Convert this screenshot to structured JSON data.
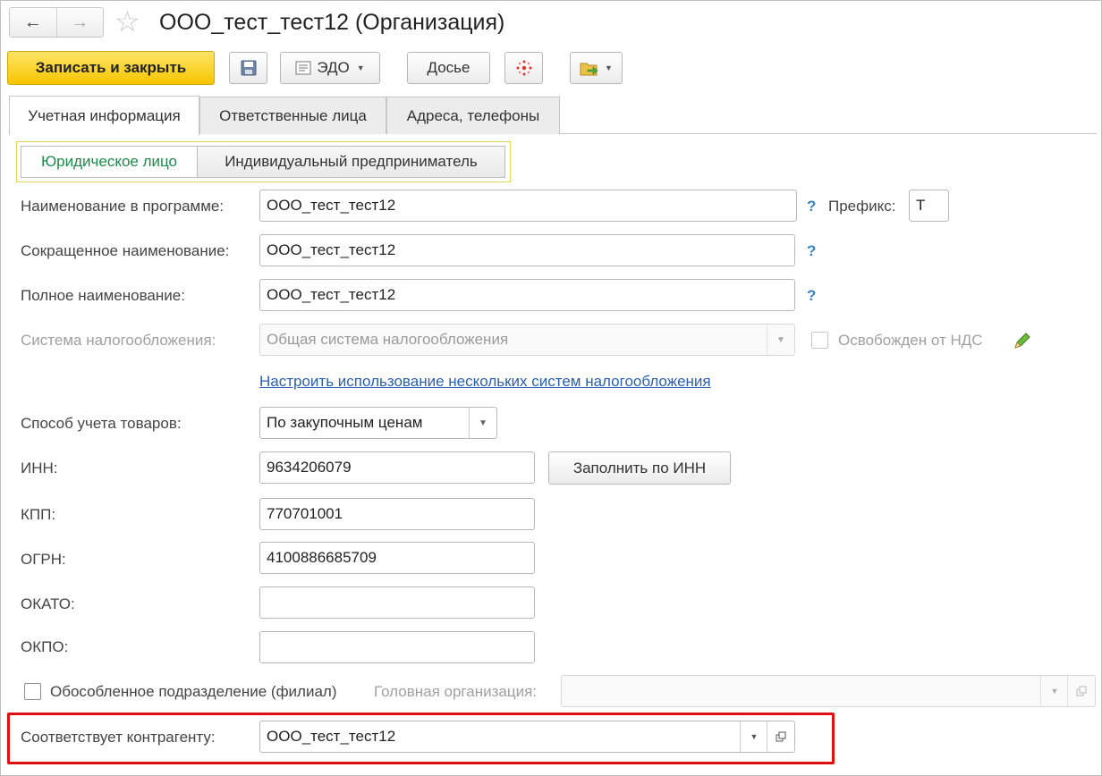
{
  "header": {
    "back_icon": "arrow-left-icon",
    "forward_icon": "arrow-right-icon",
    "favorite_icon": "star-icon",
    "title": "ООО_тест_тест12 (Организация)"
  },
  "toolbar": {
    "save_close": "Записать и закрыть",
    "edo": "ЭДО",
    "dossier": "Досье"
  },
  "tabs": [
    {
      "label": "Учетная информация"
    },
    {
      "label": "Ответственные лица"
    },
    {
      "label": "Адреса, телефоны"
    }
  ],
  "entity_type": {
    "legal": "Юридическое лицо",
    "individual": "Индивидуальный предприниматель",
    "selected": "legal"
  },
  "form": {
    "name_program": {
      "label": "Наименование в программе:",
      "value": "ООО_тест_тест12"
    },
    "prefix": {
      "label": "Префикс:",
      "value": "Т"
    },
    "short_name": {
      "label": "Сокращенное наименование:",
      "value": "ООО_тест_тест12"
    },
    "full_name": {
      "label": "Полное наименование:",
      "value": "ООО_тест_тест12"
    },
    "tax_system": {
      "label": "Система налогообложения:",
      "value": "Общая система налогообложения"
    },
    "vat_exempt": {
      "label": "Освобожден от НДС",
      "checked": false
    },
    "tax_link": "Настроить использование нескольких систем налогообложения",
    "goods_accounting": {
      "label": "Способ учета товаров:",
      "value": "По закупочным ценам"
    },
    "inn": {
      "label": "ИНН:",
      "value": "9634206079"
    },
    "fill_by_inn": "Заполнить по ИНН",
    "kpp": {
      "label": "КПП:",
      "value": "770701001"
    },
    "ogrn": {
      "label": "ОГРН:",
      "value": "4100886685709"
    },
    "okato": {
      "label": "ОКАТО:",
      "value": ""
    },
    "okpo": {
      "label": "ОКПО:",
      "value": ""
    },
    "branch": {
      "label": "Обособленное подразделение (филиал)",
      "checked": false
    },
    "head_org": {
      "label": "Головная организация:",
      "value": ""
    },
    "counterparty": {
      "label": "Соответствует контрагенту:",
      "value": "ООО_тест_тест12"
    },
    "help": "?"
  },
  "colors": {
    "primary_button": "#f6c500",
    "highlight_border": "#e01010",
    "link": "#2a5fb0",
    "help": "#3b83c4"
  }
}
